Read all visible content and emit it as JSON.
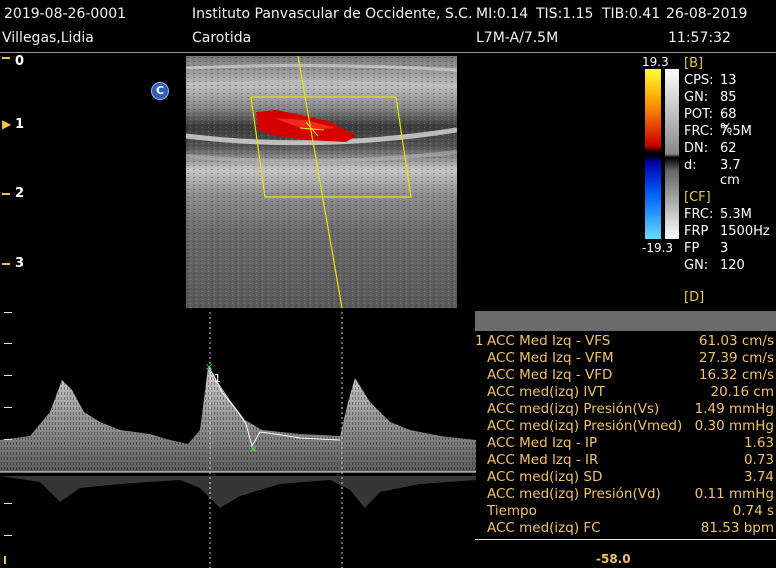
{
  "header": {
    "patient_id": "2019-08-26-0001",
    "institution": "Instituto Panvascular de Occidente, S.C.",
    "mi": "MI:0.14",
    "tis": "TIS:1.15",
    "tib": "TIB:0.41",
    "date": "26-08-2019",
    "patient_name": "Villegas,Lidia",
    "study": "Carotida",
    "probe": "L7M-A/7.5M",
    "time": "11:57:32"
  },
  "depth_scale": [
    "0",
    "1",
    "2",
    "3"
  ],
  "color_scale": {
    "top": "19.3",
    "bottom": "-19.3"
  },
  "params": {
    "b_title": "[B]",
    "b": [
      {
        "k": "CPS:",
        "v": "13"
      },
      {
        "k": "GN:",
        "v": "85"
      },
      {
        "k": "POT:",
        "v": "68 %"
      },
      {
        "k": "FRC:",
        "v": "7.5M"
      },
      {
        "k": "DN:",
        "v": "62"
      },
      {
        "k": "d:",
        "v": "3.7 cm"
      }
    ],
    "cf_title": "[CF]",
    "cf": [
      {
        "k": "FRC:",
        "v": "5.3M"
      },
      {
        "k": "FRP",
        "v": "1500Hz"
      },
      {
        "k": "FP",
        "v": "3"
      },
      {
        "k": "GN:",
        "v": "120"
      }
    ],
    "d_title": "[D]"
  },
  "markers": {
    "c_badge": "C",
    "cursor_label": "1"
  },
  "measurements": {
    "index": "1",
    "rows": [
      {
        "label": "ACC  Med Izq - VFS",
        "value": "61.03 cm/s"
      },
      {
        "label": "ACC Med Izq - VFM",
        "value": "27.39 cm/s"
      },
      {
        "label": "ACC Med Izq - VFD",
        "value": "16.32 cm/s"
      },
      {
        "label": "ACC med(izq) IVT",
        "value": "20.16 cm"
      },
      {
        "label": "ACC med(izq) Presión(Vs)",
        "value": "1.49 mmHg"
      },
      {
        "label": "ACC med(izq) Presión(Vmed)",
        "value": "0.30 mmHg"
      },
      {
        "label": "ACC Med Izq - IP",
        "value": "1.63"
      },
      {
        "label": "ACC Med Izq - IR",
        "value": "0.73"
      },
      {
        "label": "ACC med(izq) SD",
        "value": "3.74"
      },
      {
        "label": "ACC med(izq) Presión(Vd)",
        "value": "0.11 mmHg"
      },
      {
        "label": "Tiempo",
        "value": "0.74 s"
      },
      {
        "label": "ACC med(izq) FC",
        "value": "81.53 bpm"
      }
    ]
  },
  "velocity_scale_bottom": "-58.0",
  "colors": {
    "accent": "#e8c64a",
    "measure_text": "#f0c26a",
    "flow_red": "#d40000"
  }
}
